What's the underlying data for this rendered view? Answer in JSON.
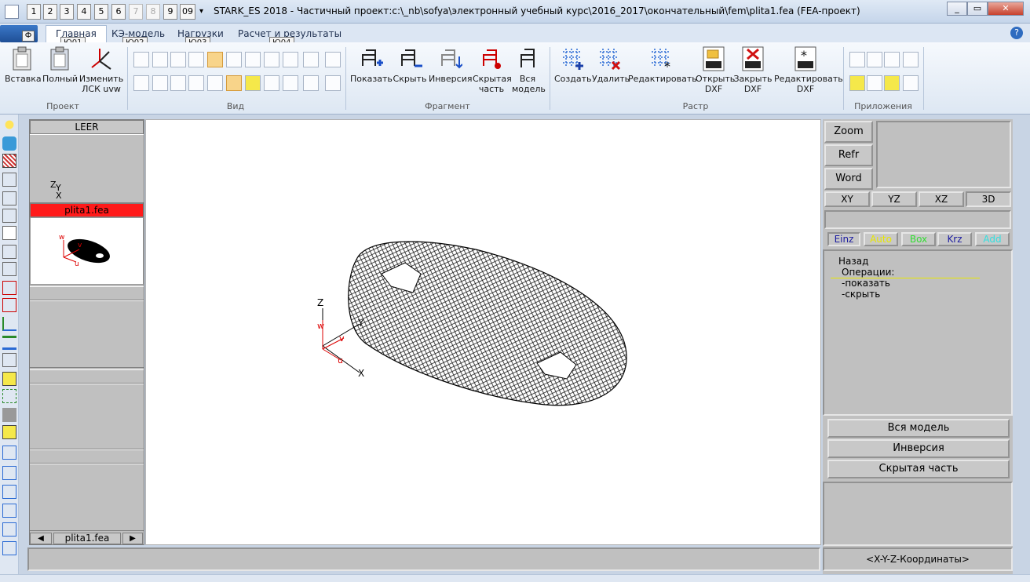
{
  "window": {
    "title": "STARK_ES 2018 - Частичный проект:c:\\_nb\\sofya\\электронный учебный курс\\2016_2017\\окончательный\\fem\\plita1.fea  (FEA-проект)",
    "quick_access": [
      "1",
      "2",
      "3",
      "4",
      "5",
      "6",
      "7",
      "8",
      "9",
      "09"
    ]
  },
  "menu": {
    "file_button": "Ф",
    "tabs": [
      "Главная",
      "КЭ-модель",
      "Нагрузки",
      "Расчет и результаты"
    ],
    "keytips": [
      "Ю01",
      "Ю02",
      "Ю03",
      "Ю04"
    ]
  },
  "ribbon": {
    "project": {
      "label": "Проект",
      "buttons": [
        {
          "label": "Вставка"
        },
        {
          "label": "Полный"
        },
        {
          "label": "Изменить ЛСК uvw"
        }
      ]
    },
    "view": {
      "label": "Вид"
    },
    "fragment": {
      "label": "Фрагмент",
      "buttons": [
        {
          "label": "Показать"
        },
        {
          "label": "Скрыть"
        },
        {
          "label": "Инверсия"
        },
        {
          "label": "Скрытая часть"
        },
        {
          "label": "Вся модель"
        }
      ]
    },
    "raster": {
      "label": "Растр",
      "buttons": [
        {
          "label": "Создать"
        },
        {
          "label": "Удалить"
        },
        {
          "label": "Редактировать"
        },
        {
          "label": "Открыть DXF"
        },
        {
          "label": "Закрыть DXF"
        },
        {
          "label": "Редактировать DXF"
        }
      ],
      "dxf_tag": "DXF"
    },
    "apps": {
      "label": "Приложения"
    }
  },
  "left_panel": {
    "header": "LEER",
    "axis_z": "Z",
    "axis_y": "Y",
    "axis_x": "X",
    "file_tab": "plita1.fea",
    "bottom_file": "plita1.fea",
    "mini_axes": {
      "w": "w",
      "v": "v",
      "u": "u"
    }
  },
  "canvas": {
    "axes": {
      "z": "Z",
      "y": "Y",
      "x": "X",
      "w": "w",
      "v": "v",
      "u": "u"
    }
  },
  "right_panel": {
    "buttons": [
      "Zoom",
      "Refr",
      "Word"
    ],
    "views": [
      "XY",
      "YZ",
      "XZ",
      "3D"
    ],
    "modes": [
      {
        "label": "Einz",
        "color": "#1a1aa0"
      },
      {
        "label": "Auto",
        "color": "#e8e800"
      },
      {
        "label": "Box",
        "color": "#33dd33"
      },
      {
        "label": "Krz",
        "color": "#1a1aa0"
      },
      {
        "label": "Add",
        "color": "#33e0e0"
      }
    ],
    "menu": {
      "back": "Назад",
      "ops": "Операции:",
      "show": "-показать",
      "hide": "-скрыть"
    },
    "actions": [
      "Вся модель",
      "Инверсия",
      "Скрытая часть"
    ],
    "coords": "<X-Y-Z-Координаты>"
  },
  "colors": {
    "accent_red": "#ff1a1a",
    "mesh": "#000000",
    "panel_gray": "#c0c0c0"
  }
}
